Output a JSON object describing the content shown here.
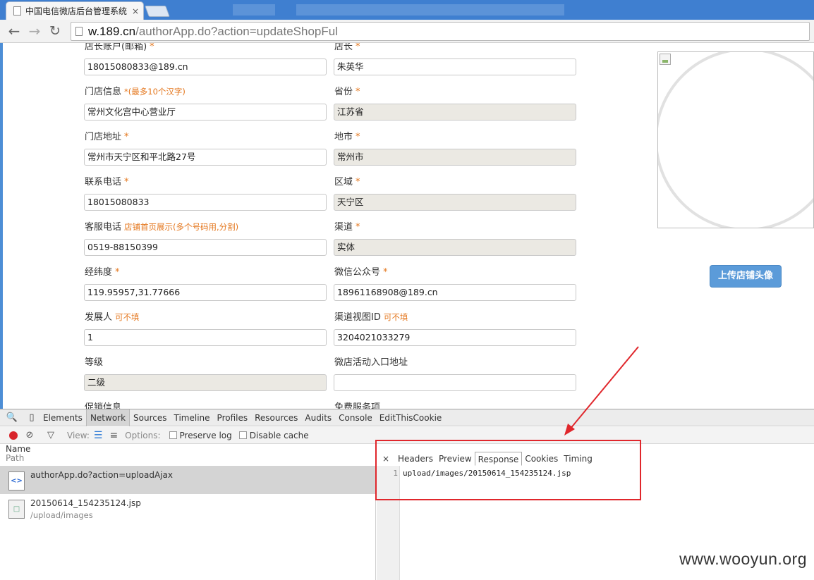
{
  "browser": {
    "tab_title": "中国电信微店后台管理系统",
    "tab_close": "×",
    "url_host": "w.189.cn",
    "url_path": "/authorApp.do?action=updateShopFul"
  },
  "form": {
    "row0": {
      "left_label": "店长账户(邮箱)",
      "left_req": "*",
      "left_value": "18015080833@189.cn",
      "right_label": "店长",
      "right_req": "*",
      "right_value": "朱英华"
    },
    "row1": {
      "left_label": "门店信息",
      "left_hint": "*(最多10个汉字)",
      "left_value": "常州文化宫中心营业厅",
      "right_label": "省份",
      "right_req": "*",
      "right_value": "江苏省"
    },
    "row2": {
      "left_label": "门店地址",
      "left_req": "*",
      "left_value": "常州市天宁区和平北路27号",
      "right_label": "地市",
      "right_req": "*",
      "right_value": "常州市"
    },
    "row3": {
      "left_label": "联系电话",
      "left_req": "*",
      "left_value": "18015080833",
      "right_label": "区域",
      "right_req": "*",
      "right_value": "天宁区"
    },
    "row4": {
      "left_label": "客服电话",
      "left_hint": "店铺首页展示(多个号码用,分割)",
      "left_value": "0519-88150399",
      "right_label": "渠道",
      "right_req": "*",
      "right_value": "实体"
    },
    "row5": {
      "left_label": "经纬度",
      "left_req": "*",
      "left_value": "119.95957,31.77666",
      "right_label": "微信公众号",
      "right_req": "*",
      "right_value": "18961168908@189.cn"
    },
    "row6": {
      "left_label": "发展人",
      "left_hint": "可不填",
      "left_value": "1",
      "right_label": "渠道视图ID",
      "right_hint": "可不填",
      "right_value": "3204021033279"
    },
    "row7": {
      "left_label": "等级",
      "left_value": "二级",
      "right_label": "微店活动入口地址",
      "right_value": ""
    },
    "row8": {
      "left_label": "促销信息",
      "right_label": "免费服务项"
    },
    "upload_button": "上传店铺头像"
  },
  "devtools": {
    "tabs": [
      "Elements",
      "Network",
      "Sources",
      "Timeline",
      "Profiles",
      "Resources",
      "Audits",
      "Console",
      "EditThisCookie"
    ],
    "active_tab": "Network",
    "view_label": "View:",
    "options_label": "Options:",
    "preserve_log": "Preserve log",
    "disable_cache": "Disable cache",
    "col_name": "Name",
    "col_path": "Path",
    "requests": [
      {
        "name": "authorApp.do?action=uploadAjax",
        "path": ""
      },
      {
        "name": "20150614_154235124.jsp",
        "path": "/upload/images"
      }
    ],
    "detail_close": "×",
    "detail_tabs": [
      "Headers",
      "Preview",
      "Response",
      "Cookies",
      "Timing"
    ],
    "active_detail_tab": "Response",
    "response_line_no": "1",
    "response_text": "upload/images/20150614_154235124.jsp"
  },
  "watermark": "www.wooyun.org",
  "colors": {
    "accent_red": "#e0272c",
    "required_orange": "#e4761c",
    "button_blue": "#5b9bd9"
  }
}
